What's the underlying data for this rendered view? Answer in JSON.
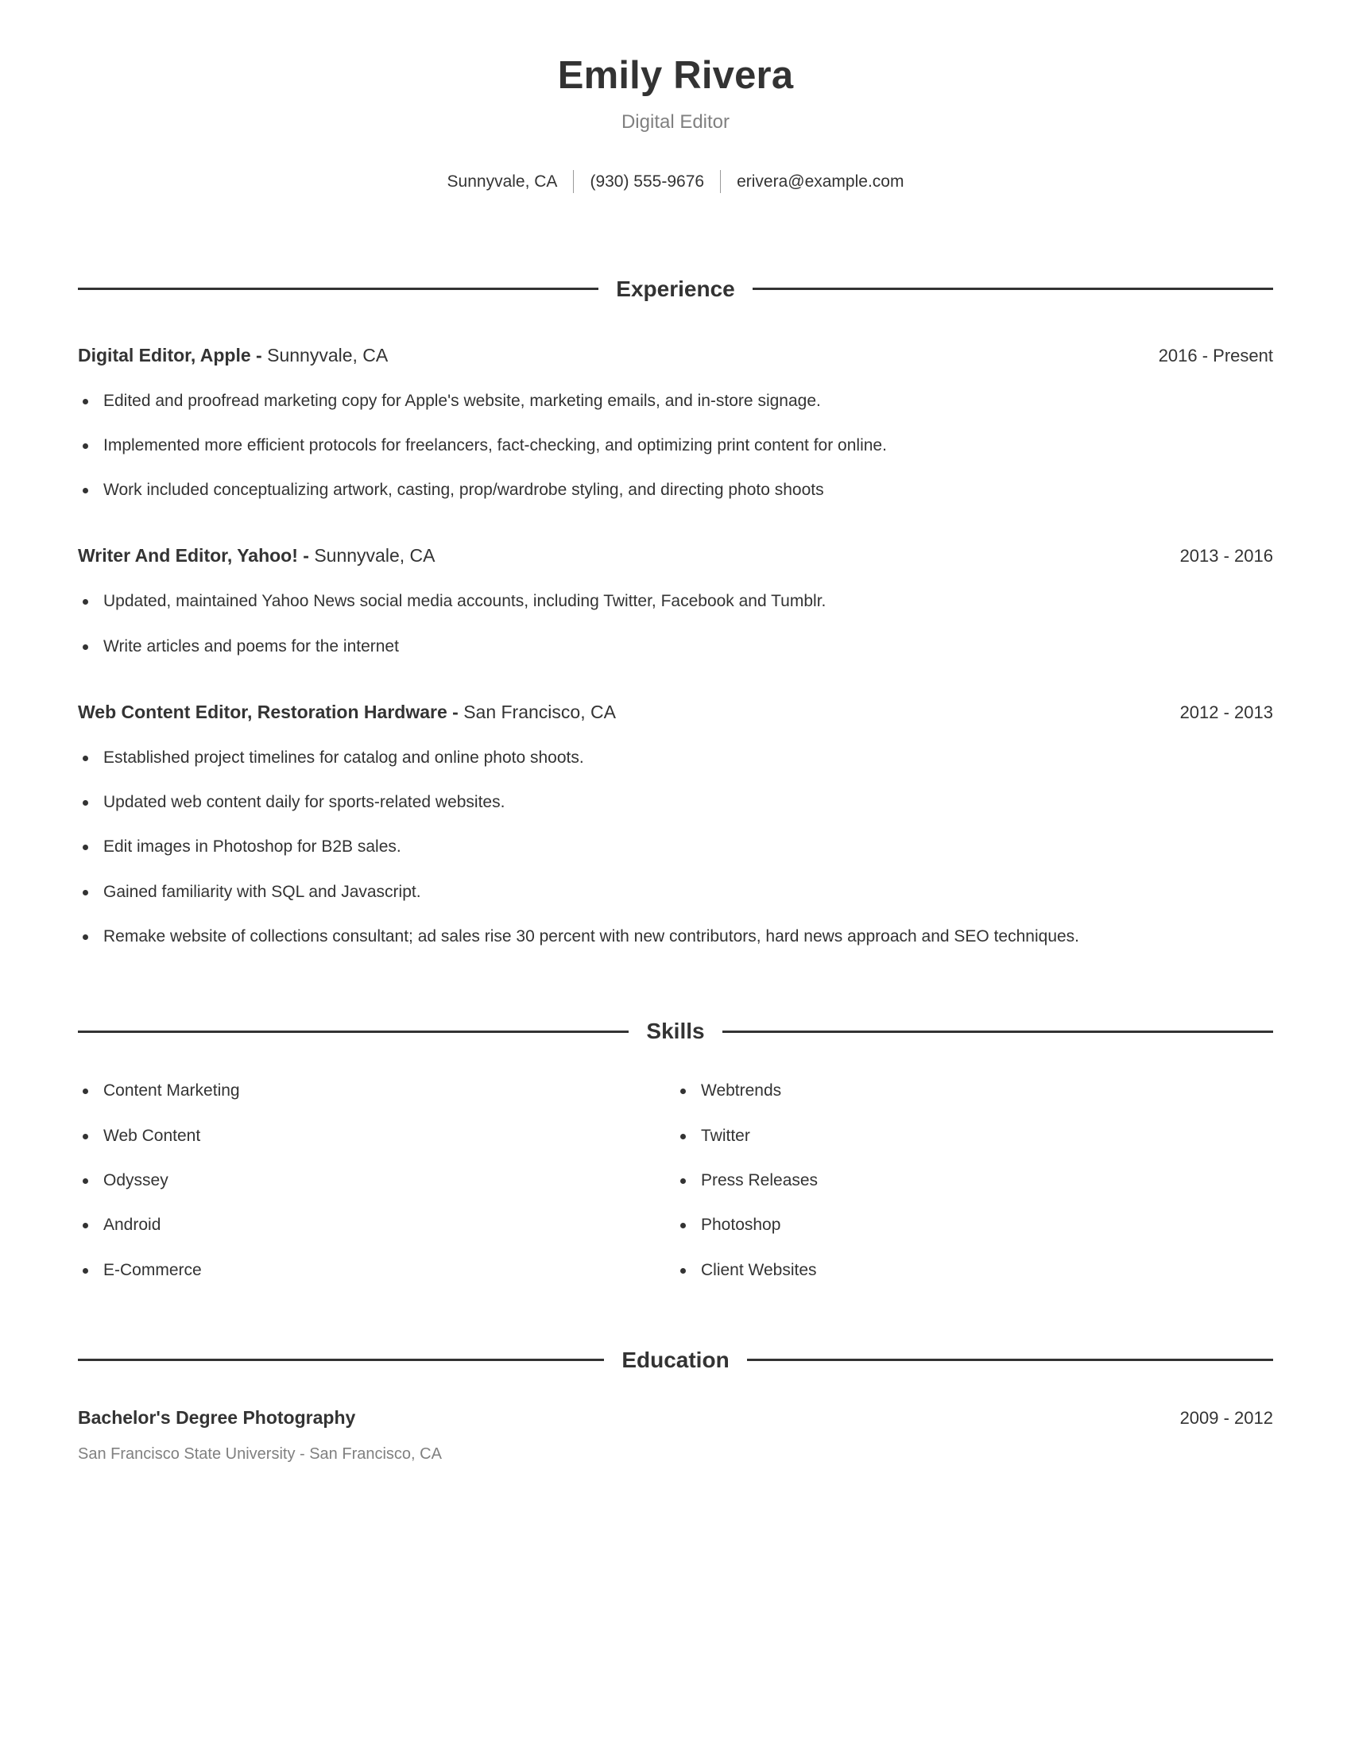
{
  "resume": {
    "name": "Emily Rivera",
    "title": "Digital Editor",
    "contact": {
      "location": "Sunnyvale, CA",
      "phone": "(930) 555-9676",
      "email": "erivera@example.com"
    }
  },
  "sections": {
    "experience": {
      "heading": "Experience",
      "entries": [
        {
          "title_bold": "Digital Editor, Apple - ",
          "title_light": "Sunnyvale, CA",
          "dates": "2016 - Present",
          "bullets": [
            "Edited and proofread marketing copy for Apple's website, marketing emails, and in-store signage.",
            "Implemented more efficient protocols for freelancers, fact-checking, and optimizing print content for online.",
            "Work included conceptualizing artwork, casting, prop/wardrobe styling, and directing photo shoots"
          ]
        },
        {
          "title_bold": "Writer And Editor, Yahoo! - ",
          "title_light": "Sunnyvale, CA",
          "dates": "2013 - 2016",
          "bullets": [
            "Updated, maintained Yahoo News social media accounts, including Twitter, Facebook and Tumblr.",
            "Write articles and poems for the internet"
          ]
        },
        {
          "title_bold": "Web Content Editor, Restoration Hardware - ",
          "title_light": "San Francisco, CA",
          "dates": "2012 - 2013",
          "bullets": [
            "Established project timelines for catalog and online photo shoots.",
            "Updated web content daily for sports-related websites.",
            "Edit images in Photoshop for B2B sales.",
            "Gained familiarity with SQL and Javascript.",
            "Remake website of collections consultant; ad sales rise 30 percent with new contributors, hard news approach and SEO techniques."
          ]
        }
      ]
    },
    "skills": {
      "heading": "Skills",
      "column_left": [
        "Content Marketing",
        "Web Content",
        "Odyssey",
        "Android",
        "E-Commerce"
      ],
      "column_right": [
        "Webtrends",
        "Twitter",
        "Press Releases",
        "Photoshop",
        "Client Websites"
      ]
    },
    "education": {
      "heading": "Education",
      "entries": [
        {
          "degree": "Bachelor's Degree Photography",
          "dates": "2009 - 2012",
          "school": "San Francisco State University - San Francisco, CA"
        }
      ]
    }
  },
  "colors": {
    "text": "#333333",
    "muted": "#808080",
    "rule": "#333333",
    "background": "#ffffff"
  }
}
